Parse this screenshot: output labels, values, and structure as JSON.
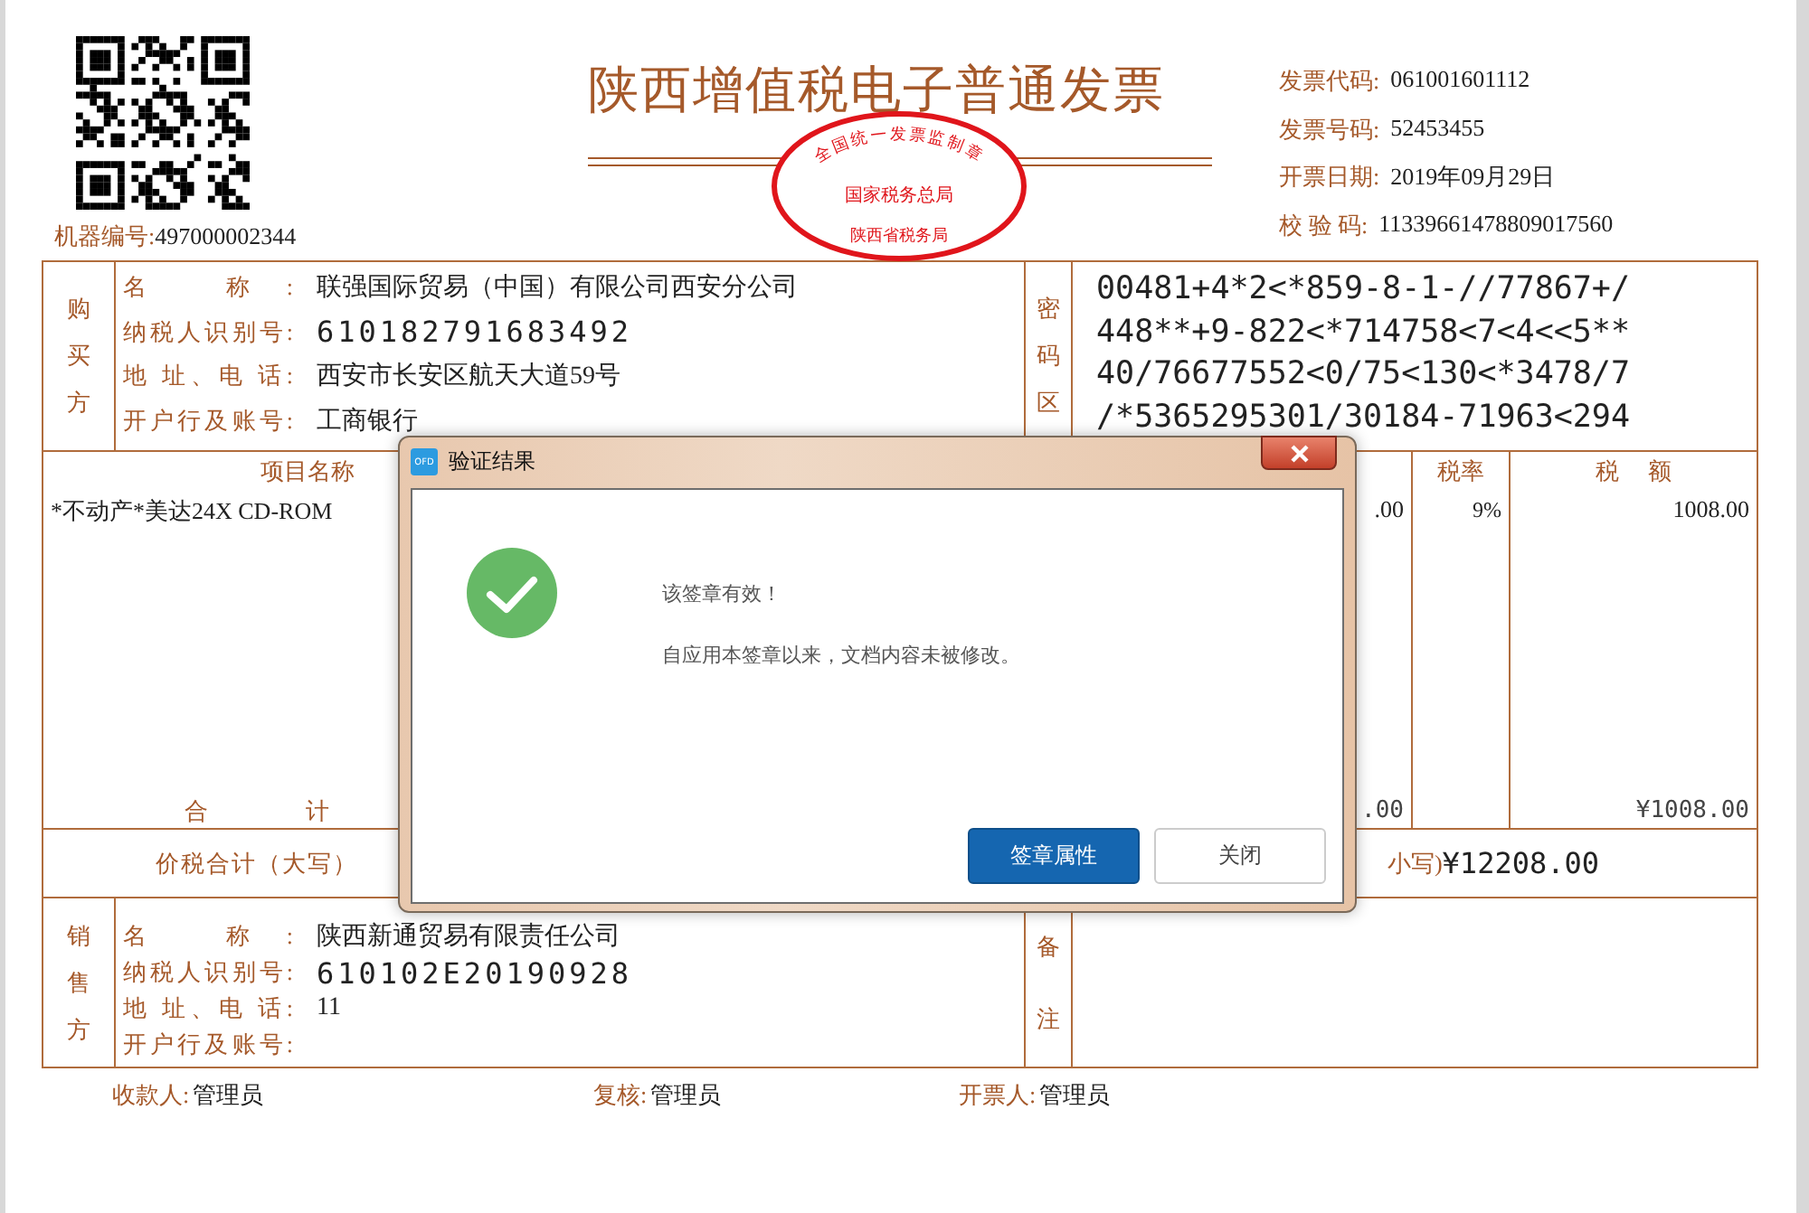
{
  "machine_number": {
    "label": "机器编号:",
    "value": "497000002344"
  },
  "title": "陕西增值税电子普通发票",
  "seal": {
    "top": "全国统一发票监制章",
    "middle": "国家税务总局",
    "bottom": "陕西省税务局"
  },
  "invoice_info": [
    {
      "label": "发票代码:",
      "value": "061001601112"
    },
    {
      "label": "发票号码:",
      "value": "52453455"
    },
    {
      "label": "开票日期:",
      "value": "2019年09月29日"
    },
    {
      "label": "校 验 码:",
      "value": "11339661478809017560"
    }
  ],
  "buyer": {
    "heading": "购买方",
    "fields": [
      {
        "label": "名 称:",
        "value": "联强国际贸易（中国）有限公司西安分公司",
        "kind": "text"
      },
      {
        "label": "纳税人识别号:",
        "value": "610182791683492",
        "kind": "code"
      },
      {
        "label": "地 址、电 话:",
        "value": "西安市长安区航天大道59号",
        "kind": "text"
      },
      {
        "label": "开户行及账号:",
        "value": "工商银行",
        "kind": "text"
      }
    ],
    "side_heading": "密码区",
    "side_lines": [
      "00481+4*2<*859-8-1-//77867+/",
      "448**+9-822<*714758<7<4<<5**",
      "40/76677552<0/75<130<*3478/7",
      "/*5365295301/30184-71963<294"
    ]
  },
  "items": {
    "headers": {
      "name": "项目名称",
      "tax_rate": "税率",
      "tax_amount": "税 额"
    },
    "rows": [
      {
        "name": "*不动产*美达24X CD-ROM",
        "column_4": ".00",
        "tax_rate": "9%",
        "tax_amount": "1008.00"
      }
    ],
    "total": {
      "label": "合 计",
      "column_4": ".00",
      "tax_amount": "¥1008.00"
    }
  },
  "grand_total": {
    "label": "价税合计（大写）",
    "small_label": "小写)",
    "value": "¥12208.00"
  },
  "seller": {
    "heading": "销售方",
    "fields": [
      {
        "label": "名 称:",
        "value": "陕西新通贸易有限责任公司",
        "kind": "text"
      },
      {
        "label": "纳税人识别号:",
        "value": "610102E20190928",
        "kind": "code"
      },
      {
        "label": "地 址、电 话:",
        "value": "11",
        "kind": "text"
      },
      {
        "label": "开户行及账号:"
      }
    ],
    "side_heading": "备注"
  },
  "footer": [
    {
      "label": "收款人:",
      "value": "管理员"
    },
    {
      "label": "复核:",
      "value": "管理员"
    },
    {
      "label": "开票人:",
      "value": "管理员"
    }
  ],
  "dialog": {
    "title": "验证结果",
    "app_badge": "OFD",
    "messages": [
      "该签章有效！",
      "自应用本签章以来，文档内容未被修改。"
    ],
    "buttons": [
      {
        "label": "签章属性",
        "primary": true
      },
      {
        "label": "关闭",
        "primary": false
      }
    ]
  }
}
